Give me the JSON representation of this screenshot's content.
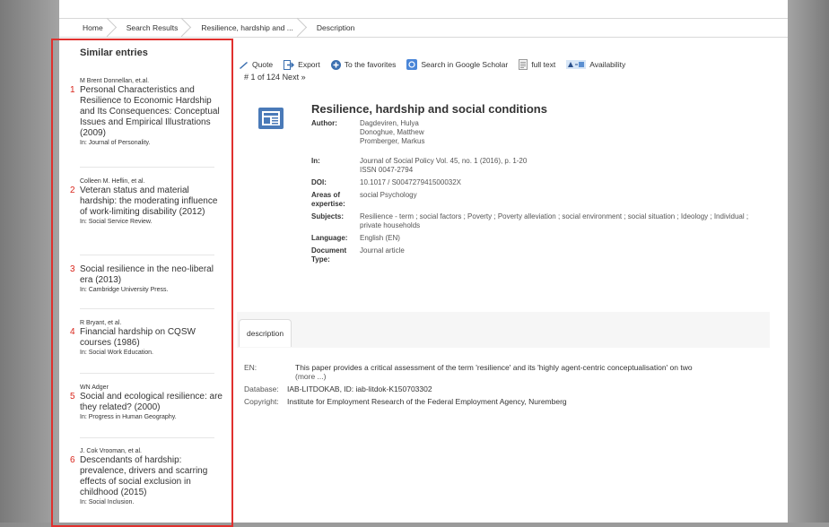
{
  "breadcrumb": [
    "Home",
    "Search Results",
    "Resilience, hardship and ...",
    "Description"
  ],
  "sidebar": {
    "heading": "Similar entries",
    "entries": [
      {
        "num": "1",
        "authors": "M Brent Donnellan, et.al.",
        "title": "Personal Characteristics and Resilience to Economic Hardship and Its Consequences: Conceptual Issues and Empirical Illustrations (2009)",
        "in": "In: Journal of Personality."
      },
      {
        "num": "2",
        "authors": "Colleen M. Heflin, et al.",
        "title": "Veteran status and material hardship: the moderating influence of work-limiting disability (2012)",
        "in": "In: Social Service Review."
      },
      {
        "num": "3",
        "authors": "",
        "title": "Social resilience in the neo-liberal era (2013)",
        "in": "In: Cambridge University Press."
      },
      {
        "num": "4",
        "authors": "R Bryant, et al.",
        "title": "Financial hardship on CQSW courses (1986)",
        "in": "In: Social Work Education."
      },
      {
        "num": "5",
        "authors": "WN Adger",
        "title": "Social and ecological resilience: are they related? (2000)",
        "in": "In: Progress in Human Geography."
      },
      {
        "num": "6",
        "authors": "J. Cok Vrooman, et al.",
        "title": "Descendants of hardship: prevalence, drivers and scarring effects of social exclusion in childhood (2015)",
        "in": "In: Social Inclusion."
      }
    ]
  },
  "toolbar": {
    "quote": "Quote",
    "export": "Export",
    "favorites": "To the favorites",
    "scholar": "Search in Google Scholar",
    "fulltext": "full text",
    "availability": "Availability"
  },
  "hits": {
    "text": "# 1 of 124",
    "next": "Next »"
  },
  "record": {
    "title": "Resilience, hardship and social conditions",
    "author_label": "Author:",
    "authors": [
      "Dagdeviren, Hulya",
      "Donoghue, Matthew",
      "Promberger, Markus"
    ],
    "in_label": "In:",
    "in": [
      "Journal of Social Policy Vol. 45, no. 1 (2016), p. 1-20",
      "ISSN 0047-2794"
    ],
    "doi_label": "DOI:",
    "doi": "10.1017 / S004727941500032X",
    "areas_label": "Areas of expertise:",
    "areas": "social Psychology",
    "subjects_label": "Subjects:",
    "subjects": "Resilience - term ; social factors ; Poverty ; Poverty alleviation ; social environment ; social situation ; Ideology ; Individual ; private households",
    "language_label": "Language:",
    "language": "English (EN)",
    "doctype_label": "Document Type:",
    "doctype": "Journal article"
  },
  "tab": "description",
  "description": {
    "en_label": "EN:",
    "en": "This paper provides a critical assessment of the term 'resilience' and its 'highly agent-centric conceptualisation' on two",
    "more": "(more ...)",
    "db_label": "Database:",
    "db": "IAB-LITDOKAB, ID: iab-litdok-K150703302",
    "copyright_label": "Copyright:",
    "copyright": "Institute for Employment Research of the Federal Employment Agency, Nuremberg"
  },
  "colors": {
    "highlight": "#e0302e",
    "icon_blue": "#3a6fb0",
    "number_red": "#d9261c"
  }
}
